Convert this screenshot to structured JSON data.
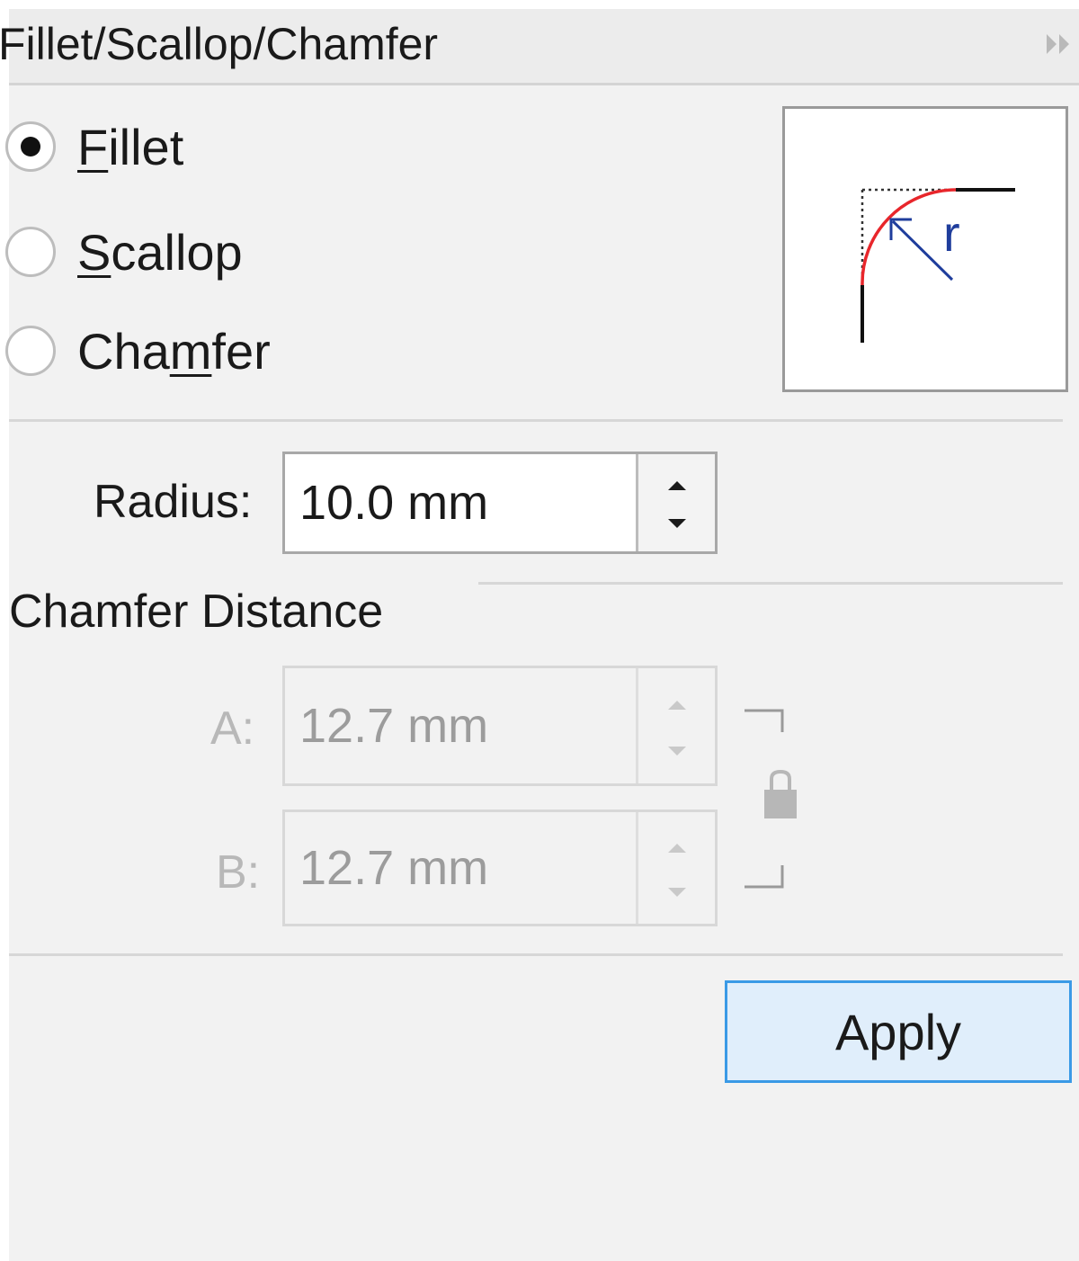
{
  "panel": {
    "title": "Fillet/Scallop/Chamfer",
    "collapse_icon": "double-chevron-right-icon"
  },
  "mode": {
    "options": [
      {
        "pre": "",
        "mnemonic": "F",
        "post": "illet",
        "checked": true
      },
      {
        "pre": "",
        "mnemonic": "S",
        "post": "callop",
        "checked": false
      },
      {
        "pre": "Cha",
        "mnemonic": "m",
        "post": "fer",
        "checked": false
      }
    ],
    "preview_label": "r",
    "preview_icon": "fillet-corner-preview-icon"
  },
  "radius": {
    "label": "Radius:",
    "value": "10.0 mm"
  },
  "chamfer_distance": {
    "title": "Chamfer Distance",
    "a_label": "A:",
    "a_value": "12.7 mm",
    "b_label": "B:",
    "b_value": "12.7 mm",
    "lock_icon": "lock-icon",
    "enabled": false
  },
  "actions": {
    "apply_label": "Apply"
  },
  "colors": {
    "accent": "#3a9ae6",
    "fillet_curve": "#e8262b",
    "radius_arrow": "#1f3d9c"
  }
}
